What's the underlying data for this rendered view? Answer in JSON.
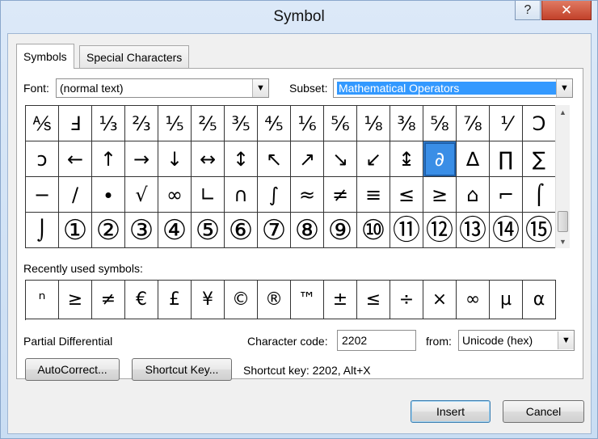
{
  "window": {
    "title": "Symbol",
    "help": "?",
    "close": "✕"
  },
  "tabs": [
    {
      "label": "Symbols"
    },
    {
      "label": "Special Characters"
    }
  ],
  "font": {
    "label": "Font:",
    "value": "(normal text)"
  },
  "subset": {
    "label": "Subset:",
    "value": "Mathematical Operators"
  },
  "symbol_grid": {
    "rows": [
      [
        "⅍",
        "Ⅎ",
        "⅓",
        "⅔",
        "⅕",
        "⅖",
        "⅗",
        "⅘",
        "⅙",
        "⅚",
        "⅛",
        "⅜",
        "⅝",
        "⅞",
        "⅟",
        "Ↄ"
      ],
      [
        "ↄ",
        "←",
        "↑",
        "→",
        "↓",
        "↔",
        "↕",
        "↖",
        "↗",
        "↘",
        "↙",
        "↨",
        "∂",
        "∆",
        "∏",
        "∑"
      ],
      [
        "−",
        "∕",
        "∙",
        "√",
        "∞",
        "∟",
        "∩",
        "∫",
        "≈",
        "≠",
        "≡",
        "≤",
        "≥",
        "⌂",
        "⌐",
        "⌠"
      ],
      [
        "⌡",
        "①",
        "②",
        "③",
        "④",
        "⑤",
        "⑥",
        "⑦",
        "⑧",
        "⑨",
        "⑩",
        "⑪",
        "⑫",
        "⑬",
        "⑭",
        "⑮"
      ]
    ],
    "selected": "∂"
  },
  "recent": {
    "label": "Recently used symbols:",
    "symbols": [
      "ⁿ",
      "≥",
      "≠",
      "€",
      "£",
      "¥",
      "©",
      "®",
      "™",
      "±",
      "≤",
      "÷",
      "×",
      "∞",
      "µ",
      "α"
    ]
  },
  "char_name": "Partial Differential",
  "char_code": {
    "label": "Character code:",
    "value": "2202"
  },
  "from": {
    "label": "from:",
    "value": "Unicode (hex)"
  },
  "buttons": {
    "autocorrect": "AutoCorrect...",
    "shortcut_key": "Shortcut Key...",
    "insert": "Insert",
    "cancel": "Cancel"
  },
  "shortcut_text": "Shortcut key: 2202, Alt+X",
  "colors": {
    "selection": "#3a8ee6",
    "close": "#c2412a"
  }
}
